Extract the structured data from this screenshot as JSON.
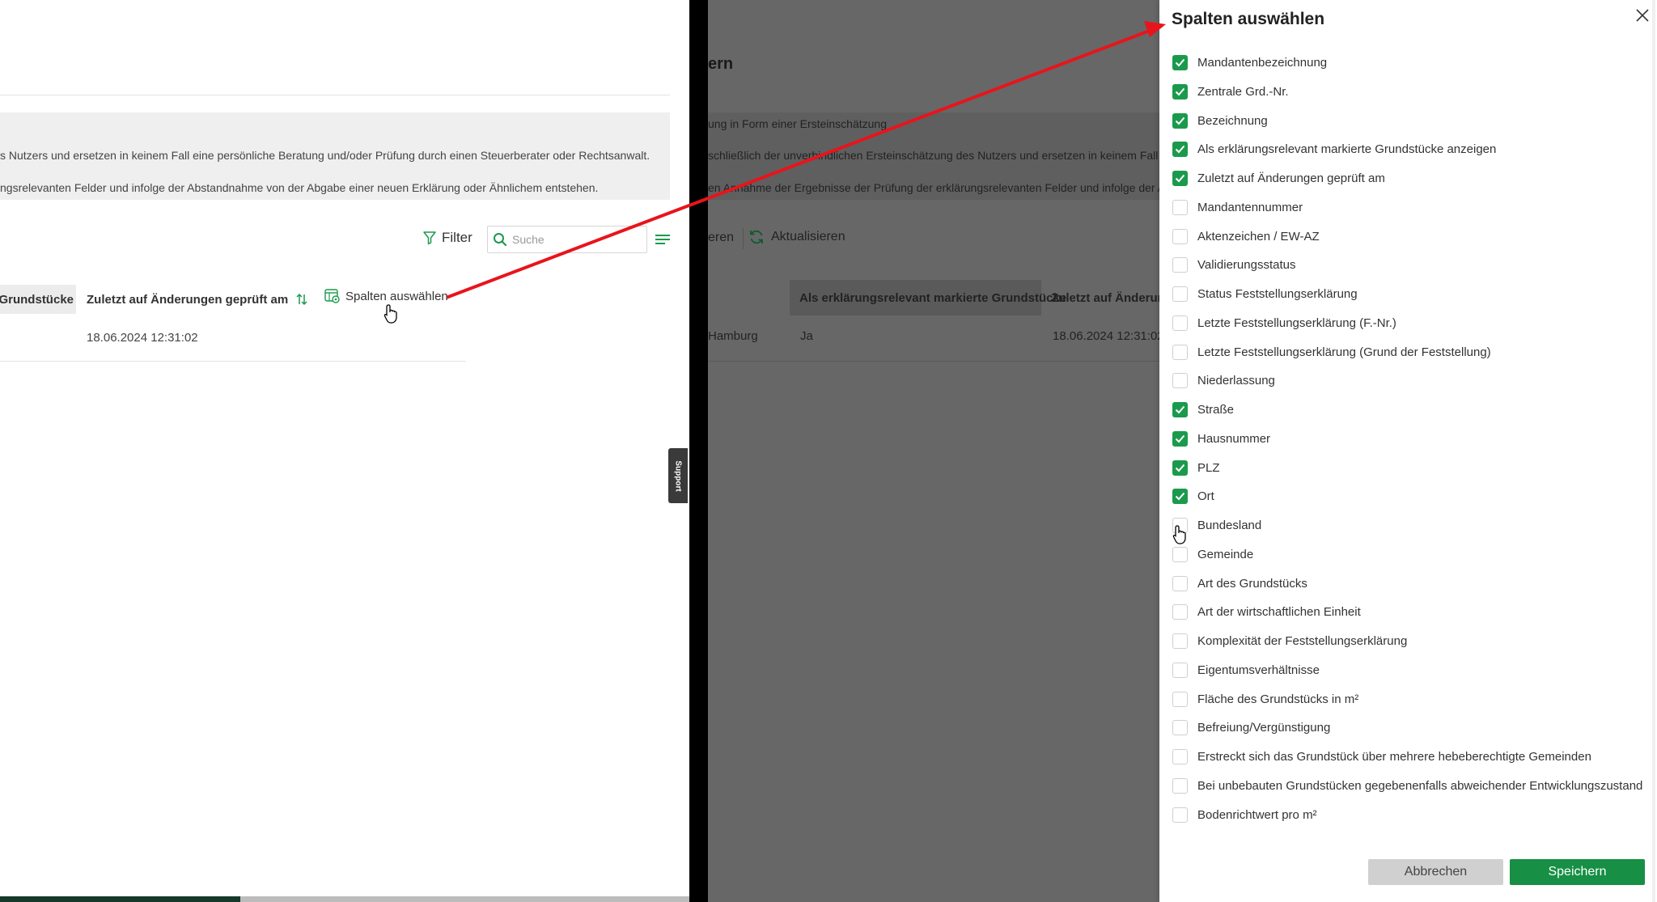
{
  "left": {
    "notice_lines": [
      "s Nutzers und ersetzen in keinem Fall eine persönliche Beratung und/oder Prüfung durch einen Steuerberater oder Rechtsanwalt.",
      "ngsrelevanten Felder und infolge der Abstandnahme von der Abgabe einer neuen Erklärung oder Ähnlichem entstehen."
    ],
    "filter_label": "Filter",
    "search_placeholder": "Suche",
    "table": {
      "col1": "e Grundstücke",
      "col2": "Zuletzt auf Änderungen geprüft am",
      "col3": "Spalten auswählen",
      "row_date": "18.06.2024 12:31:02"
    },
    "support_label": "Support"
  },
  "middle": {
    "title": "ern",
    "notice_lines": [
      "ung in Form einer Ersteinschätzung",
      "schließlich der unverbindlichen Ersteinschätzung des Nutzers und ersetzen in keinem Fall ei",
      "en Annahme der Ergebnisse der Prüfung der erklärungsrelevanten Felder und infolge der A"
    ],
    "toolbar_partial": "eren",
    "refresh_label": "Aktualisieren",
    "table": {
      "col_a": "Als erklärungsrelevant markierte Grundstücke",
      "col_b": "Zuletzt auf Änderung",
      "cell_city": "Hamburg",
      "cell_flag": "Ja",
      "cell_date": "18.06.2024 12:31:02"
    }
  },
  "dialog": {
    "title": "Spalten auswählen",
    "options": [
      {
        "label": "Mandantenbezeichnung",
        "checked": true
      },
      {
        "label": "Zentrale Grd.-Nr.",
        "checked": true
      },
      {
        "label": "Bezeichnung",
        "checked": true
      },
      {
        "label": "Als erklärungsrelevant markierte Grundstücke anzeigen",
        "checked": true
      },
      {
        "label": "Zuletzt auf Änderungen geprüft am",
        "checked": true
      },
      {
        "label": "Mandantennummer",
        "checked": false
      },
      {
        "label": "Aktenzeichen / EW-AZ",
        "checked": false
      },
      {
        "label": "Validierungsstatus",
        "checked": false
      },
      {
        "label": "Status Feststellungserklärung",
        "checked": false
      },
      {
        "label": "Letzte Feststellungserklärung (F.-Nr.)",
        "checked": false
      },
      {
        "label": "Letzte Feststellungserklärung (Grund der Feststellung)",
        "checked": false
      },
      {
        "label": "Niederlassung",
        "checked": false
      },
      {
        "label": "Straße",
        "checked": true
      },
      {
        "label": "Hausnummer",
        "checked": true
      },
      {
        "label": "PLZ",
        "checked": true
      },
      {
        "label": "Ort",
        "checked": true
      },
      {
        "label": "Bundesland",
        "checked": false
      },
      {
        "label": "Gemeinde",
        "checked": false
      },
      {
        "label": "Art des Grundstücks",
        "checked": false
      },
      {
        "label": "Art der wirtschaftlichen Einheit",
        "checked": false
      },
      {
        "label": "Komplexität der Feststellungserklärung",
        "checked": false
      },
      {
        "label": "Eigentumsverhältnisse",
        "checked": false
      },
      {
        "label": "Fläche des Grundstücks in m²",
        "checked": false
      },
      {
        "label": "Befreiung/Vergünstigung",
        "checked": false
      },
      {
        "label": "Erstreckt sich das Grundstück über mehrere hebeberechtigte Gemeinden",
        "checked": false
      },
      {
        "label": "Bei unbebauten Grundstücken gegebenenfalls abweichender Entwicklungszustand",
        "checked": false
      },
      {
        "label": "Bodenrichtwert pro m²",
        "checked": false
      }
    ],
    "cancel_label": "Abbrechen",
    "save_label": "Speichern"
  },
  "colors": {
    "accent_green": "#1b9a4c",
    "save_green": "#178f44",
    "arrow_red": "#e8141c",
    "overlay_gray": "#676767"
  }
}
